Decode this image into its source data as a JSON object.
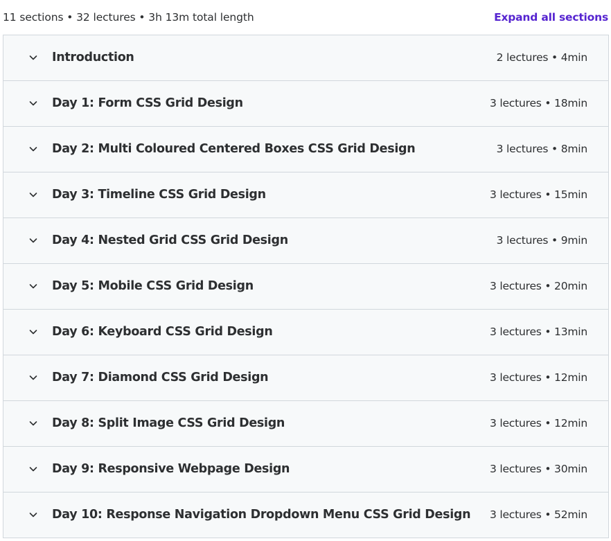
{
  "header": {
    "summary": "11 sections • 32 lectures • 3h 13m total length",
    "expand_all_label": "Expand all sections"
  },
  "icons": {
    "section_toggle": "chevron-down-icon"
  },
  "colors": {
    "accent": "#5624d0",
    "row_background": "#f7f9fa",
    "border": "#d1d7dc",
    "text": "#2d2f31"
  },
  "sections": [
    {
      "title": "Introduction",
      "meta": "2 lectures • 4min"
    },
    {
      "title": "Day 1: Form CSS Grid Design",
      "meta": "3 lectures • 18min"
    },
    {
      "title": "Day 2: Multi Coloured Centered Boxes CSS Grid Design",
      "meta": "3 lectures • 8min"
    },
    {
      "title": "Day 3: Timeline CSS Grid Design",
      "meta": "3 lectures • 15min"
    },
    {
      "title": "Day 4: Nested Grid CSS Grid Design",
      "meta": "3 lectures • 9min"
    },
    {
      "title": "Day 5: Mobile CSS Grid Design",
      "meta": "3 lectures • 20min"
    },
    {
      "title": "Day 6: Keyboard CSS Grid Design",
      "meta": "3 lectures • 13min"
    },
    {
      "title": "Day 7: Diamond CSS Grid Design",
      "meta": "3 lectures • 12min"
    },
    {
      "title": "Day 8: Split Image CSS Grid Design",
      "meta": "3 lectures • 12min"
    },
    {
      "title": "Day 9: Responsive Webpage Design",
      "meta": "3 lectures • 30min"
    },
    {
      "title": "Day 10: Response Navigation Dropdown Menu CSS Grid Design",
      "meta": "3 lectures • 52min"
    }
  ]
}
